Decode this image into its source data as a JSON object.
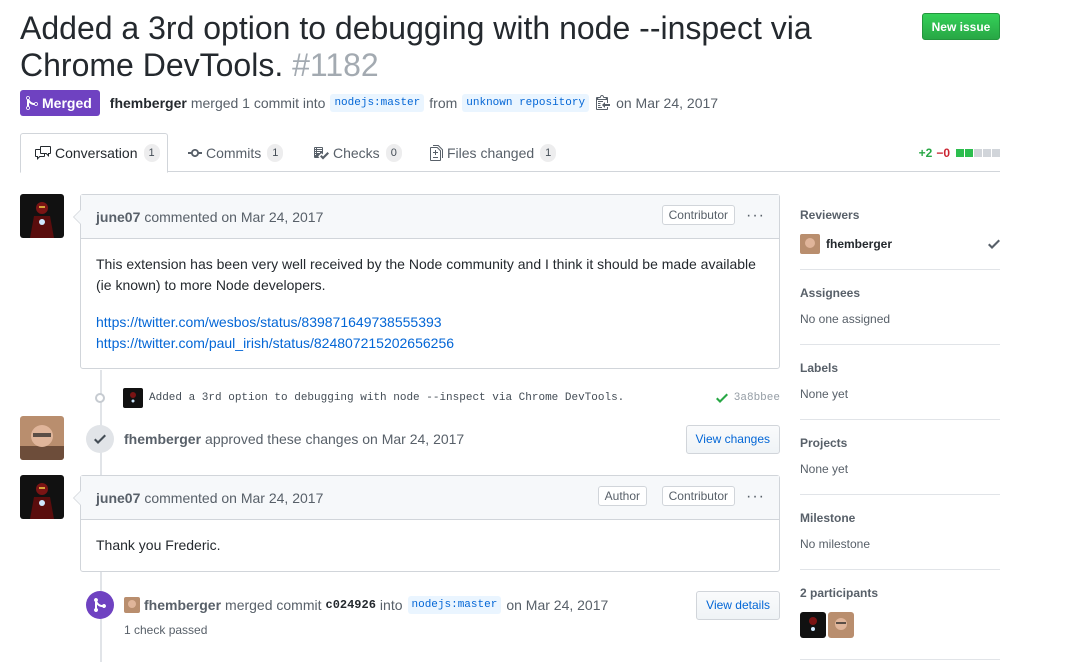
{
  "header": {
    "title": "Added a 3rd option to debugging with node --inspect via Chrome DevTools.",
    "number": "#1182",
    "new_issue": "New issue"
  },
  "status": {
    "state": "Merged",
    "author": "fhemberger",
    "text1": "merged 1 commit into",
    "base_branch": "nodejs:master",
    "text2": "from",
    "head_branch": "unknown repository",
    "date": "on Mar 24, 2017"
  },
  "tabs": [
    {
      "label": "Conversation",
      "count": "1"
    },
    {
      "label": "Commits",
      "count": "1"
    },
    {
      "label": "Checks",
      "count": "0"
    },
    {
      "label": "Files changed",
      "count": "1"
    }
  ],
  "diffstat": {
    "additions": "+2",
    "deletions": "−0"
  },
  "comment1": {
    "author": "june07",
    "meta": "commented on Mar 24, 2017",
    "role": "Contributor",
    "body": "This extension has been very well received by the Node community and I think it should be made available (ie known) to more Node developers.",
    "link1": "https://twitter.com/wesbos/status/839871649738555393",
    "link2": "https://twitter.com/paul_irish/status/824807215202656256"
  },
  "commit": {
    "message": "Added a 3rd option to debugging with node --inspect via Chrome DevTools.",
    "sha": "3a8bbee"
  },
  "review": {
    "author": "fhemberger",
    "text": "approved these changes on Mar 24, 2017",
    "button": "View changes"
  },
  "comment2": {
    "author": "june07",
    "meta": "commented on Mar 24, 2017",
    "role1": "Author",
    "role2": "Contributor",
    "body": "Thank you Frederic."
  },
  "merge_event": {
    "author": "fhemberger",
    "text1": "merged commit",
    "sha": "c024926",
    "text2": "into",
    "branch": "nodejs:master",
    "date": "on Mar 24, 2017",
    "button": "View details",
    "checks": "1 check passed"
  },
  "sidebar": {
    "reviewers_label": "Reviewers",
    "reviewer": "fhemberger",
    "assignees_label": "Assignees",
    "assignees_value": "No one assigned",
    "labels_label": "Labels",
    "labels_value": "None yet",
    "projects_label": "Projects",
    "projects_value": "None yet",
    "milestone_label": "Milestone",
    "milestone_value": "No milestone",
    "participants_label": "2 participants"
  },
  "colors": {
    "merged_purple": "#6f42c1",
    "link_blue": "#0366d6",
    "success_green": "#28a745"
  }
}
